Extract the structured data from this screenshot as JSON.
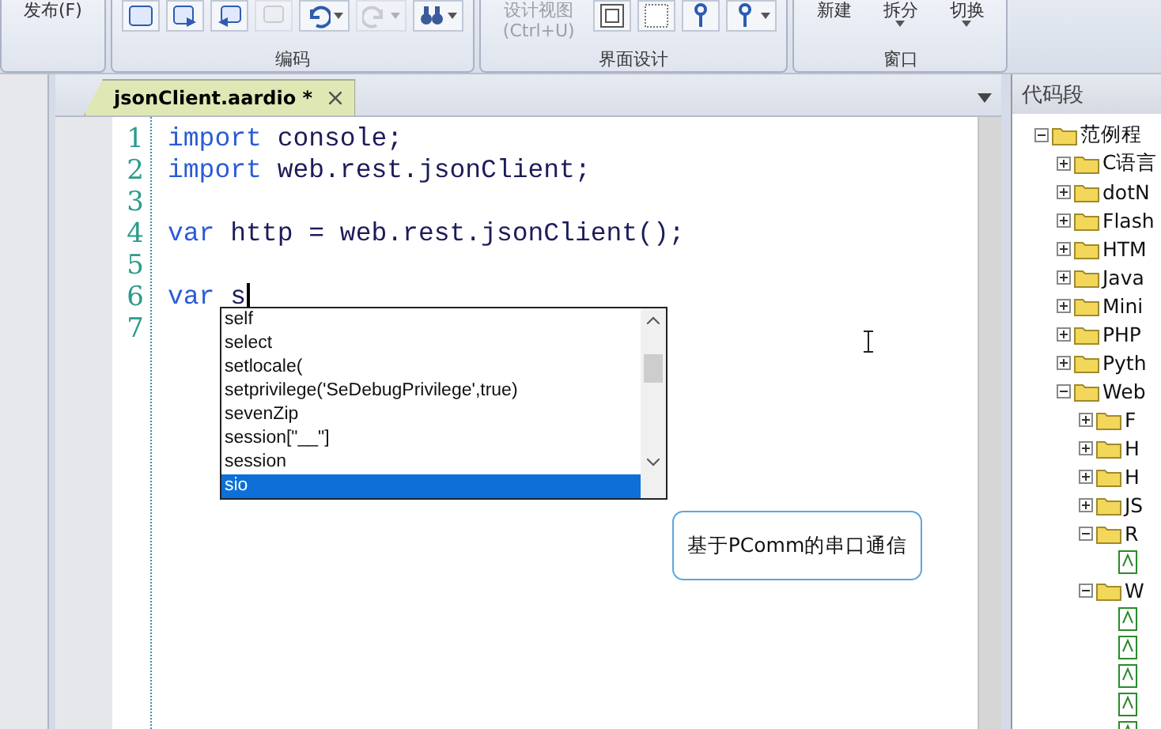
{
  "ribbon": {
    "groups": [
      {
        "buttons": [
          {
            "kind": "text",
            "label": "发布(F)"
          }
        ]
      },
      {
        "label": "编码",
        "buttons": [
          {
            "kind": "icon",
            "disabled": false
          },
          {
            "kind": "icon",
            "disabled": false
          },
          {
            "kind": "icon",
            "disabled": false
          },
          {
            "kind": "icon",
            "disabled": true
          },
          {
            "kind": "icon",
            "disabled": false,
            "dropdown": true
          },
          {
            "kind": "icon",
            "disabled": true,
            "dropdown": true
          },
          {
            "kind": "icon",
            "disabled": false,
            "dropdown": true
          }
        ]
      },
      {
        "label": "界面设计",
        "buttons": [
          {
            "kind": "text",
            "label": "设计视图",
            "sub": "(Ctrl+U)",
            "disabled": true
          },
          {
            "kind": "icon",
            "disabled": false
          },
          {
            "kind": "icon",
            "disabled": false
          },
          {
            "kind": "icon",
            "disabled": false
          },
          {
            "kind": "icon",
            "disabled": false,
            "dropdown": true
          }
        ]
      },
      {
        "label": "窗口",
        "buttons": [
          {
            "kind": "text",
            "label": "新建"
          },
          {
            "kind": "text",
            "label": "拆分",
            "dropdown": true
          },
          {
            "kind": "text",
            "label": "切换",
            "dropdown": true
          }
        ]
      }
    ]
  },
  "tabs": [
    {
      "label": "jsonClient.aardio *",
      "selected": true
    }
  ],
  "editor": {
    "lines": [
      {
        "number": "1",
        "tokens": [
          {
            "kind": "keyword",
            "text": "import"
          },
          {
            "kind": "plain",
            "text": " console;"
          }
        ]
      },
      {
        "number": "2",
        "tokens": [
          {
            "kind": "keyword",
            "text": "import"
          },
          {
            "kind": "plain",
            "text": " web.rest.jsonClient;"
          }
        ]
      },
      {
        "number": "3"
      },
      {
        "number": "4",
        "tokens": [
          {
            "kind": "keyword",
            "text": "var"
          },
          {
            "kind": "plain",
            "text": " http = web.rest.jsonClient();"
          }
        ]
      },
      {
        "number": "5"
      },
      {
        "number": "6",
        "tokens": [
          {
            "kind": "keyword",
            "text": "var"
          },
          {
            "kind": "plain",
            "text": " s"
          }
        ],
        "cursor": true
      },
      {
        "number": "7"
      }
    ]
  },
  "autocomplete": {
    "items": [
      {
        "label": "self",
        "selected": false
      },
      {
        "label": "select",
        "selected": false
      },
      {
        "label": "setlocale(",
        "selected": false
      },
      {
        "label": "setprivilege('SeDebugPrivilege',true)",
        "selected": false
      },
      {
        "label": "sevenZip",
        "selected": false
      },
      {
        "label": "session[\"__\"]",
        "selected": false
      },
      {
        "label": "session",
        "selected": false
      },
      {
        "label": "sio",
        "selected": true
      }
    ]
  },
  "tooltip": "基于PComm的串口通信",
  "snippets": {
    "title": "代码段",
    "tree": [
      {
        "kind": "folder",
        "label": "范例程",
        "expanded": true,
        "children": [
          {
            "kind": "folder",
            "label": "C语言",
            "expanded": false
          },
          {
            "kind": "folder",
            "label": "dotN",
            "expanded": false
          },
          {
            "kind": "folder",
            "label": "Flash",
            "expanded": false
          },
          {
            "kind": "folder",
            "label": "HTM",
            "expanded": false
          },
          {
            "kind": "folder",
            "label": "Java",
            "expanded": false
          },
          {
            "kind": "folder",
            "label": "Mini",
            "expanded": false
          },
          {
            "kind": "folder",
            "label": "PHP",
            "expanded": false
          },
          {
            "kind": "folder",
            "label": "Pyth",
            "expanded": false
          },
          {
            "kind": "folder",
            "label": "Web",
            "expanded": true,
            "children": [
              {
                "kind": "folder",
                "label": "F",
                "expanded": false
              },
              {
                "kind": "folder",
                "label": "H",
                "expanded": false
              },
              {
                "kind": "folder",
                "label": "H",
                "expanded": false
              },
              {
                "kind": "folder",
                "label": "JS",
                "expanded": false
              },
              {
                "kind": "folder",
                "label": "R",
                "expanded": true,
                "children": [
                  {
                    "kind": "file"
                  }
                ]
              },
              {
                "kind": "folder",
                "label": "W",
                "expanded": true,
                "children": [
                  {
                    "kind": "file"
                  },
                  {
                    "kind": "file"
                  },
                  {
                    "kind": "file"
                  },
                  {
                    "kind": "file"
                  },
                  {
                    "kind": "file"
                  }
                ]
              }
            ]
          }
        ]
      }
    ]
  }
}
